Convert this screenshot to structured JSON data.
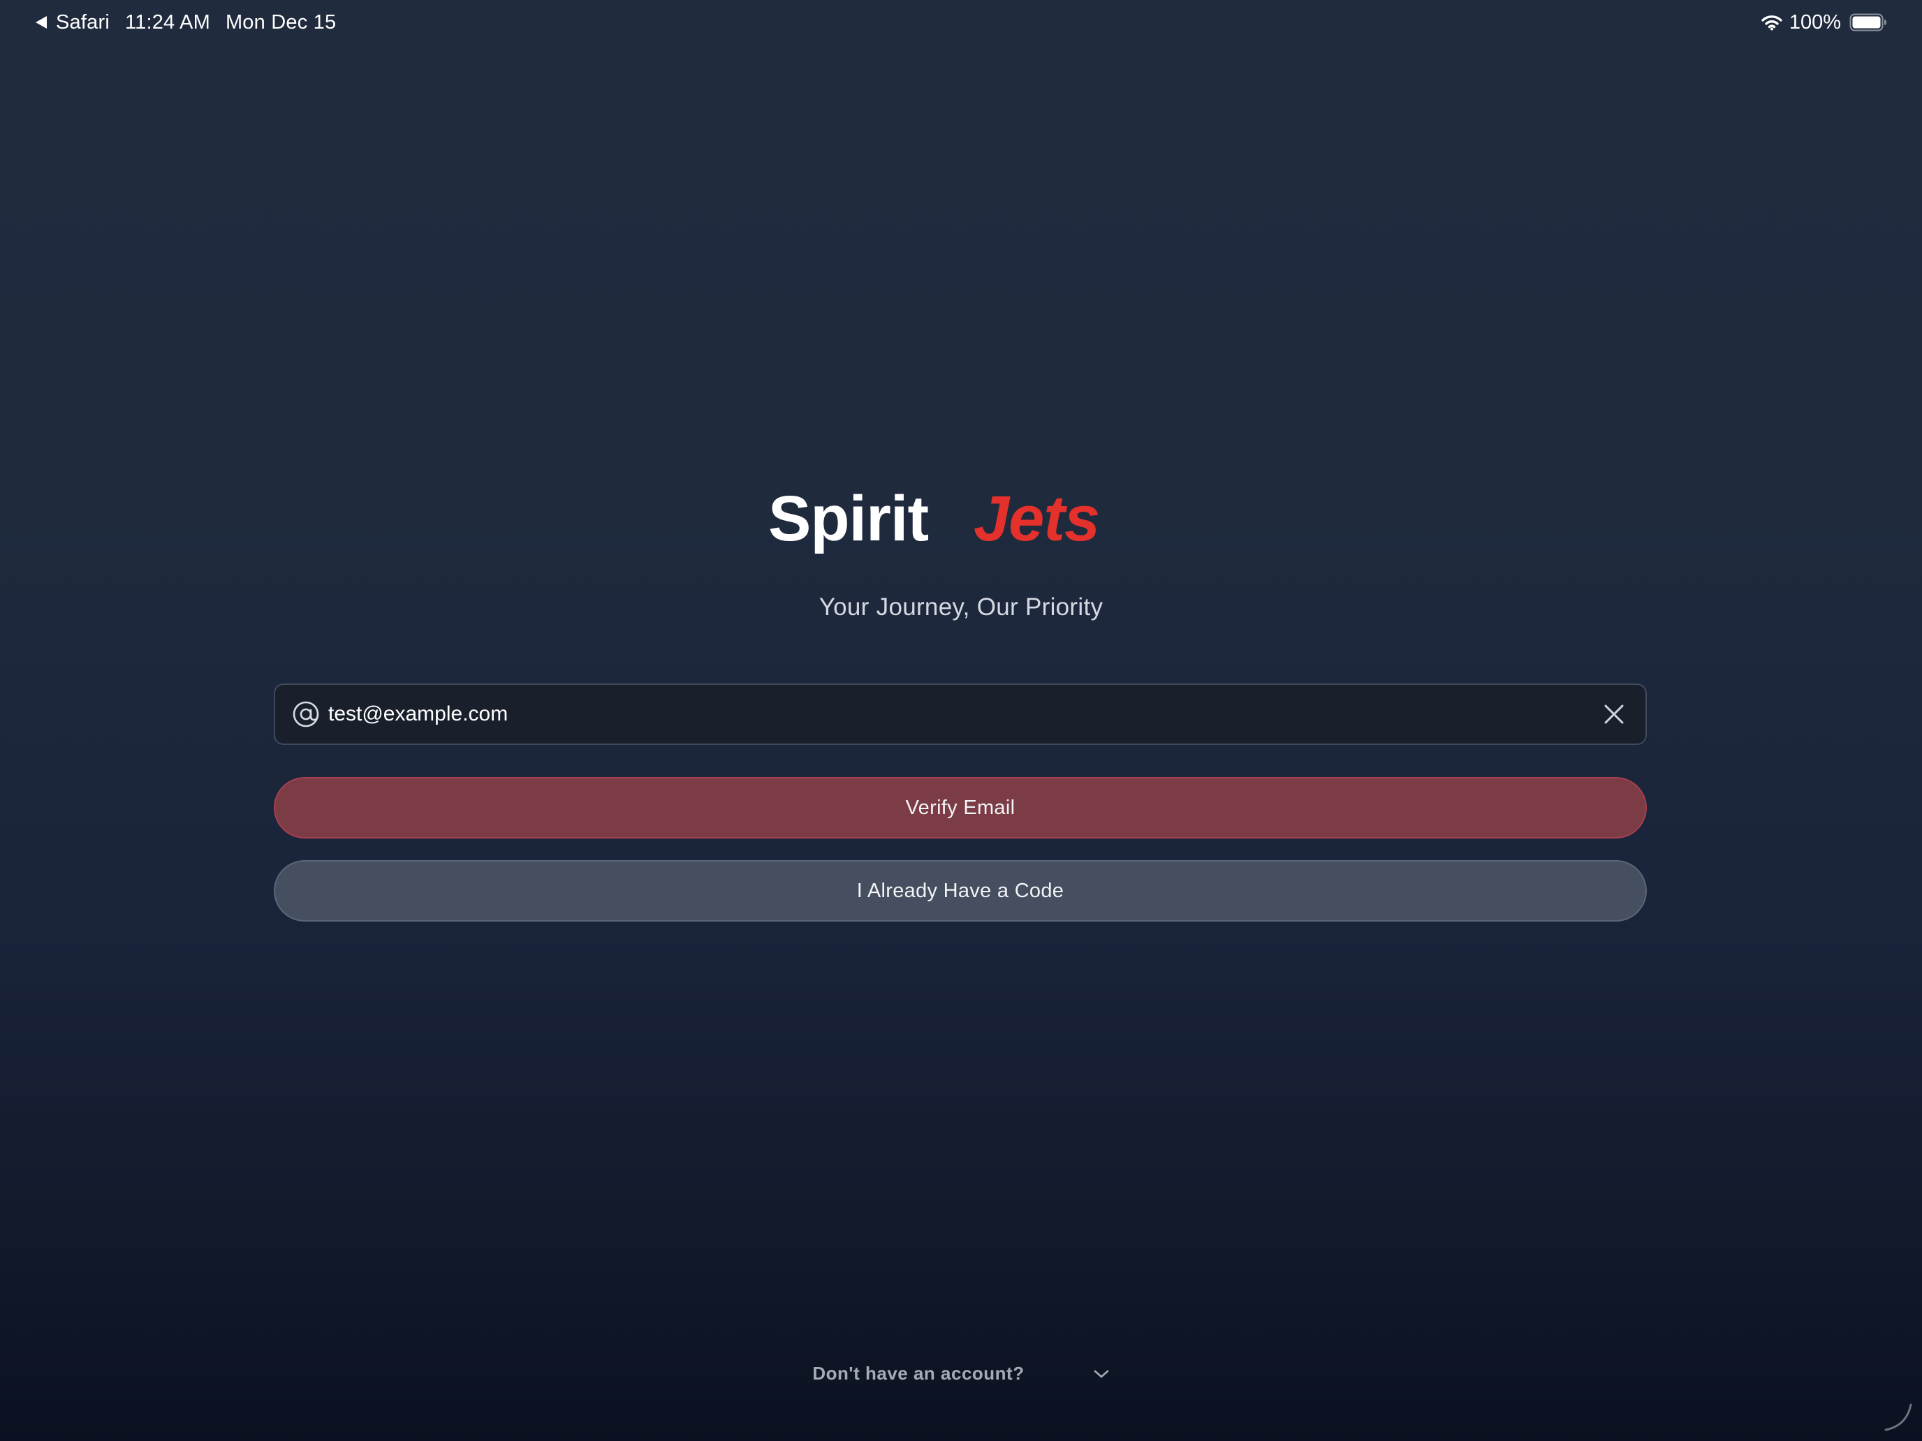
{
  "status_bar": {
    "back_app": "Safari",
    "time": "11:24 AM",
    "date": "Mon Dec 15",
    "battery": "100%"
  },
  "brand": {
    "name_part1": "Spirit",
    "name_part2": "Jets",
    "tagline": "Your Journey, Our Priority",
    "colors": {
      "white_part": "#ffffff",
      "red_part": "#e4312b"
    }
  },
  "email_field": {
    "value": "test@example.com",
    "icon": "at-icon",
    "clear_icon": "close-icon"
  },
  "buttons": {
    "verify_label": "Verify Email",
    "code_label": "I Already Have a Code"
  },
  "footer": {
    "text": "Don't have an account?",
    "icon": "chevron-down-icon"
  },
  "colors": {
    "background_top": "#202b3e",
    "background_bottom": "#0b1120",
    "verify_button": "#7b3c46",
    "secondary_button": "#454f60",
    "input_background": "#1a202b"
  }
}
